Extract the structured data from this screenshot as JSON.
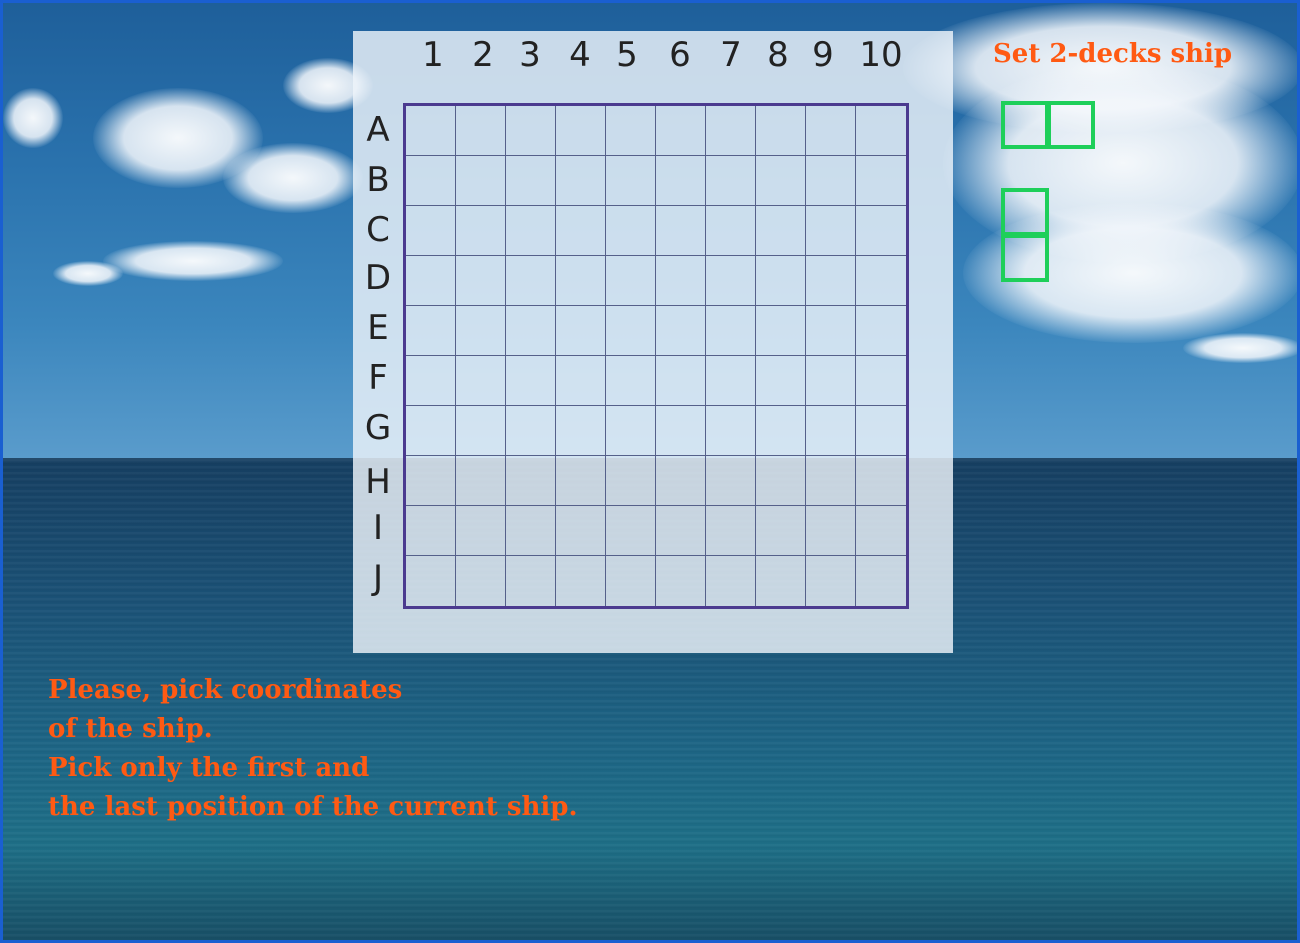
{
  "game": {
    "column_labels": [
      "1",
      "2",
      "3",
      "4",
      "5",
      "6",
      "7",
      "8",
      "9",
      "10"
    ],
    "row_labels": [
      "A",
      "B",
      "C",
      "D",
      "E",
      "F",
      "G",
      "H",
      "I",
      "J"
    ],
    "placement_title": "Set 2-decks ship",
    "ship_orientations": [
      "horizontal",
      "vertical"
    ],
    "ship_decks": 2,
    "instructions": [
      "Please, pick coordinates",
      "of the ship.",
      "Pick only the first and",
      "the last position of the current ship."
    ]
  },
  "colors": {
    "accent_text": "#ff5a13",
    "ship_outline": "#1ecf5a",
    "grid_border": "#4b3a8f",
    "frame_border": "#1a5fd1"
  }
}
